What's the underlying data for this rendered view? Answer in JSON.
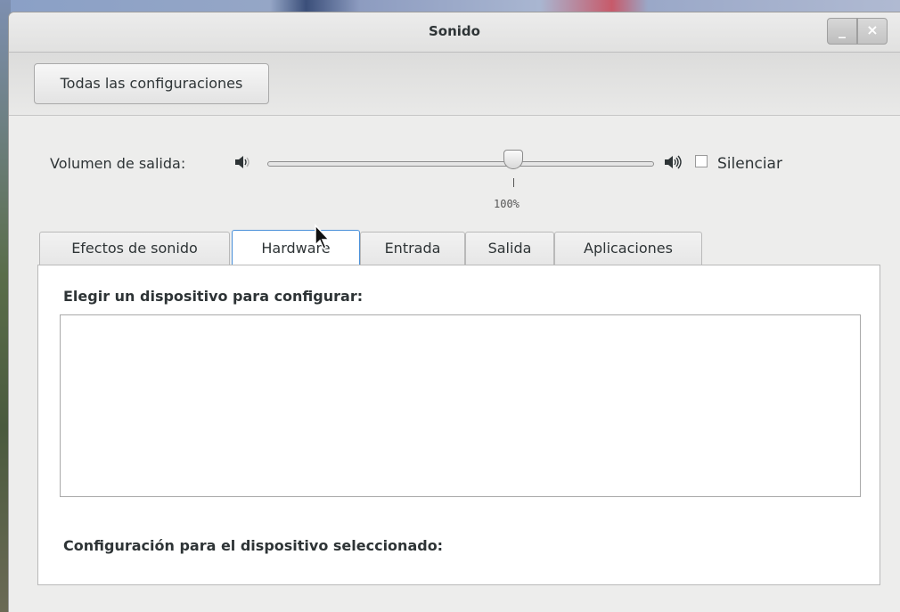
{
  "window": {
    "title": "Sonido",
    "minimize_label": "_",
    "close_label": "×"
  },
  "toolbar": {
    "all_settings_label": "Todas las configuraciones"
  },
  "volume": {
    "label": "Volumen de salida:",
    "level_percent": 100,
    "mark_label": "100%",
    "mute_label": "Silenciar",
    "muted": false,
    "icon_low": "speaker-low-icon",
    "icon_high": "speaker-high-icon"
  },
  "tabs": [
    {
      "label": "Efectos de sonido",
      "active": false
    },
    {
      "label": "Hardware",
      "active": true
    },
    {
      "label": "Entrada",
      "active": false
    },
    {
      "label": "Salida",
      "active": false
    },
    {
      "label": "Aplicaciones",
      "active": false
    }
  ],
  "hardware": {
    "choose_device_label": "Elegir un dispositivo para configurar:",
    "selected_device_config_label": "Configuración para el dispositivo seleccionado:"
  },
  "colors": {
    "active_tab_border": "#4a90d9",
    "window_bg": "#ededec"
  }
}
